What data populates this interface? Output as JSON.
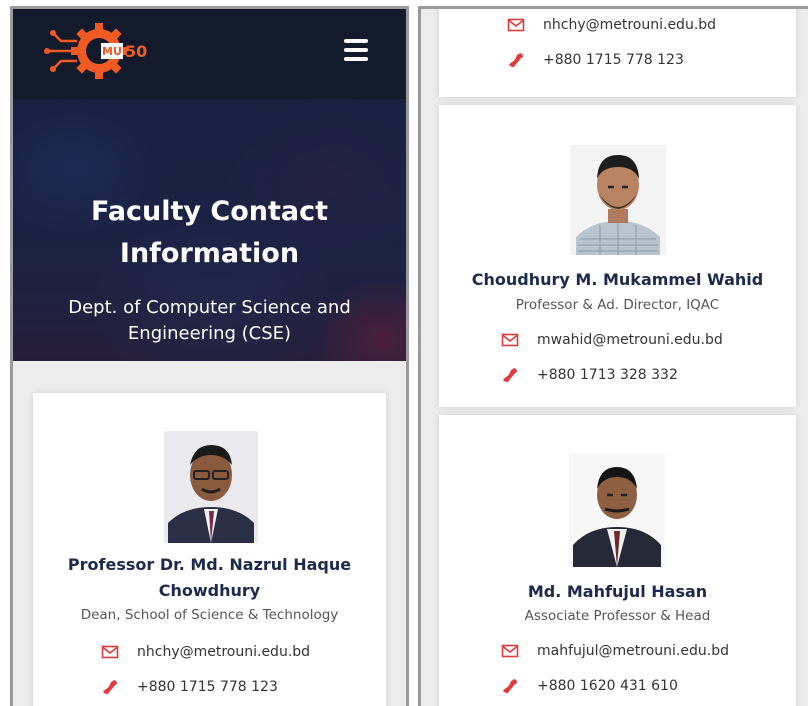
{
  "brand": {
    "logo_text": "MU 50",
    "colors": {
      "accent": "#f15a24",
      "navy": "#121a2b",
      "name": "#1d2a4d",
      "icon": "#e03b3b"
    }
  },
  "menu_icon": "hamburger-icon",
  "hero": {
    "title_line1": "Faculty Contact",
    "title_line2": "Information",
    "subtitle_line1": "Dept. of Computer Science and",
    "subtitle_line2": "Engineering (CSE)"
  },
  "faculty": [
    {
      "name_line1": "Professor Dr. Md. Nazrul Haque",
      "name_line2": "Chowdhury",
      "role": "Dean, School of Science & Technology",
      "email": "nhchy@metrouni.edu.bd",
      "phone": "+880 1715 778 123"
    },
    {
      "email": "nhchy@metrouni.edu.bd",
      "phone": "+880 1715 778 123"
    },
    {
      "name": "Choudhury M. Mukammel Wahid",
      "role": "Professor & Ad. Director, IQAC",
      "email": "mwahid@metrouni.edu.bd",
      "phone": "+880 1713 328 332"
    },
    {
      "name": "Md. Mahfujul Hasan",
      "role": "Associate Professor & Head",
      "email": "mahfujul@metrouni.edu.bd",
      "phone": "+880 1620 431 610"
    }
  ]
}
